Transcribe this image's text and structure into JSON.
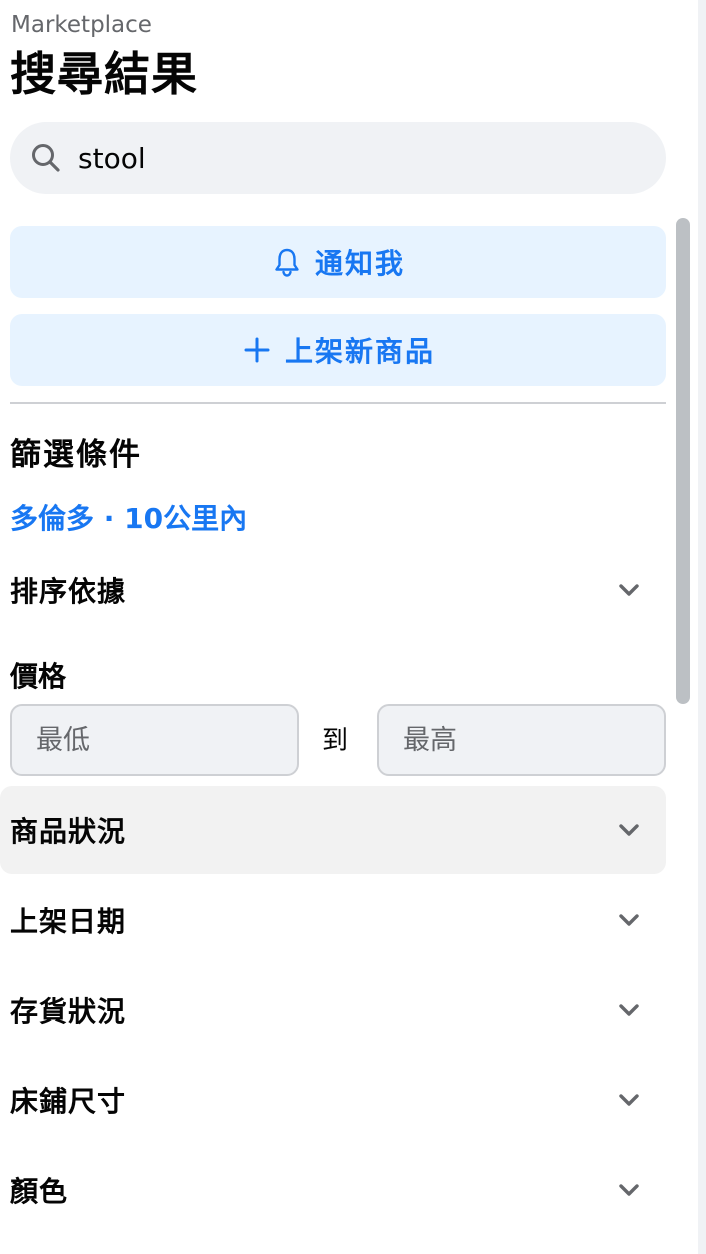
{
  "header": {
    "breadcrumb": "Marketplace",
    "title": "搜尋結果"
  },
  "search": {
    "value": "stool",
    "icon": "search-icon"
  },
  "actions": {
    "notify_label": "通知我",
    "list_item_label": "上架新商品"
  },
  "filters": {
    "title": "篩選條件",
    "location": "多倫多 · 10公里內",
    "sort_label": "排序依據",
    "price": {
      "label": "價格",
      "min_placeholder": "最低",
      "max_placeholder": "最高",
      "to_label": "到"
    },
    "condition_label": "商品狀況",
    "date_listed_label": "上架日期",
    "availability_label": "存貨狀況",
    "bed_size_label": "床鋪尺寸",
    "color_label": "顏色"
  },
  "colors": {
    "accent": "#1877f2",
    "accent_bg": "#e7f3ff",
    "input_bg": "#f0f2f5",
    "secondary_text": "#65676b"
  }
}
